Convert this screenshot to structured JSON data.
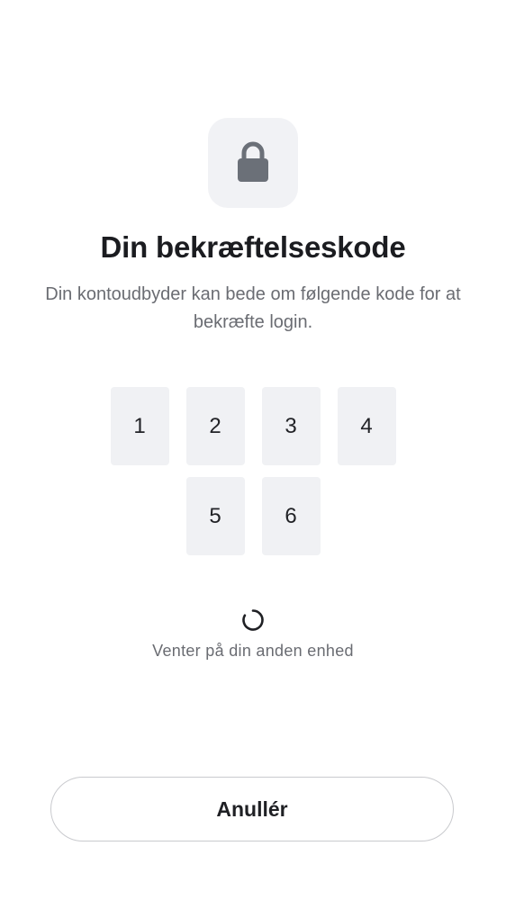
{
  "header": {
    "icon": "lock-icon",
    "title": "Din bekræftelseskode",
    "subtitle": "Din kontoudbyder kan bede om følgende kode for at bekræfte login."
  },
  "code": {
    "digits": [
      "1",
      "2",
      "3",
      "4",
      "5",
      "6"
    ]
  },
  "status": {
    "spinner_icon": "loading-spinner-icon",
    "text": "Venter på din anden enhed"
  },
  "actions": {
    "cancel_label": "Anullér"
  },
  "colors": {
    "tile_background": "#f1f2f5",
    "lock_icon": "#6b7078",
    "digit_background": "#f0f1f4",
    "muted_text": "#6a6c72",
    "button_border": "#c9cace"
  }
}
